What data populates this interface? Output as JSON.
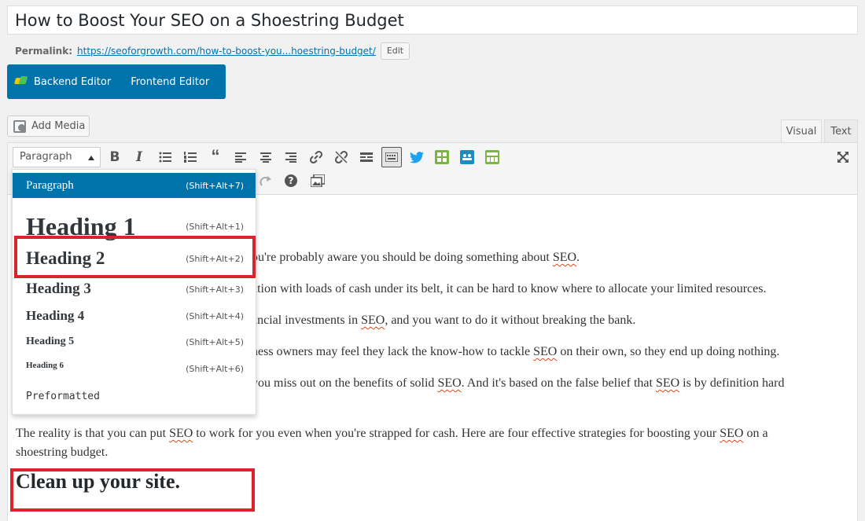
{
  "post": {
    "title": "How to Boost Your SEO on a Shoestring Budget",
    "permalink_label": "Permalink:",
    "permalink_base": "https://seoforgrowth.com/",
    "permalink_slug": "how-to-boost-you...hoestring-budget/",
    "edit_label": "Edit"
  },
  "builder": {
    "backend_label": "Backend Editor",
    "frontend_label": "Frontend Editor"
  },
  "media": {
    "add_media_label": "Add Media"
  },
  "tabs": {
    "visual": "Visual",
    "text": "Text"
  },
  "toolbar": {
    "format_value": "Paragraph",
    "icons": [
      "bold-icon",
      "italic-icon",
      "bullet-list-icon",
      "numbered-list-icon",
      "blockquote-icon",
      "align-left-icon",
      "align-center-icon",
      "align-right-icon",
      "link-icon",
      "unlink-icon",
      "read-more-icon",
      "toolbar-toggle-icon",
      "twitter-icon",
      "grid-icon",
      "team-icon",
      "layout-icon",
      "fullscreen-icon",
      "redo-icon",
      "help-icon",
      "gallery-icon"
    ]
  },
  "format_menu": {
    "items": [
      {
        "label": "Paragraph",
        "shortcut": "(Shift+Alt+7)"
      },
      {
        "label": "Heading 1",
        "shortcut": "(Shift+Alt+1)"
      },
      {
        "label": "Heading 2",
        "shortcut": "(Shift+Alt+2)"
      },
      {
        "label": "Heading 3",
        "shortcut": "(Shift+Alt+3)"
      },
      {
        "label": "Heading 4",
        "shortcut": "(Shift+Alt+4)"
      },
      {
        "label": "Heading 5",
        "shortcut": "(Shift+Alt+5)"
      },
      {
        "label": "Heading 6",
        "shortcut": "(Shift+Alt+6)"
      },
      {
        "label": "Preformatted",
        "shortcut": ""
      }
    ]
  },
  "content": {
    "p1_a": "ou're probably aware you should be doing something about ",
    "p1_seo": "SEO",
    "p1_b": ".",
    "p2": "ation with loads of cash under its belt, it can be hard to know where to allocate your limited resources.",
    "p3_a": "ancial investments in ",
    "p3_seo": "SEO",
    "p3_b": ", and you want to do it without breaking the bank.",
    "p4_a": "ness owners may feel they lack the know-how to tackle ",
    "p4_seo": "SEO",
    "p4_b": " on their own, so they end up doing nothing.",
    "p5_a": "you miss out on the benefits of solid ",
    "p5_seo": "SEO",
    "p5_b": ". And it's based on the false belief that ",
    "p5_seo2": "SEO",
    "p5_c": " is by definition hard",
    "p6_a": "The reality is that you can put ",
    "p6_seo": "SEO",
    "p6_b": " to work for you even when you're strapped for cash. Here are four effective strategies for boosting your ",
    "p6_seo2": "SEO",
    "p6_c": " on a",
    "p6_line2": "shoestring budget.",
    "heading": "Clean up your site."
  },
  "colors": {
    "accent": "#0073aa",
    "highlight": "#d9232d"
  }
}
